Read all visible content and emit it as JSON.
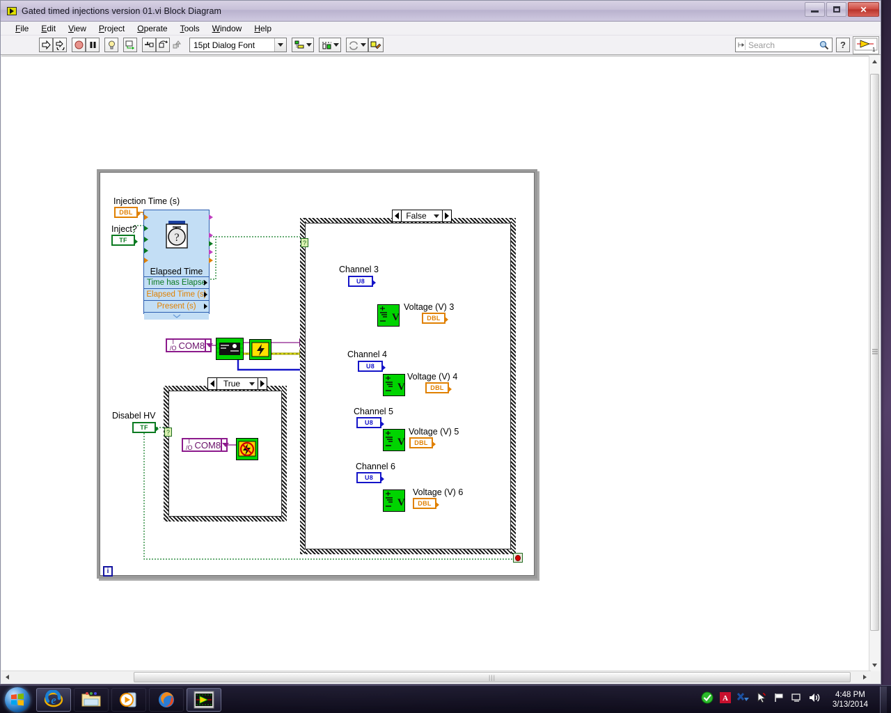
{
  "window": {
    "title": "Gated timed injections version 01.vi Block Diagram",
    "icon": "labview-vi-icon",
    "buttons": {
      "minimize": "minimize-button",
      "maximize": "maximize-button",
      "close": "✕"
    }
  },
  "menubar": {
    "items": [
      {
        "label": "File",
        "mnemonic": "F"
      },
      {
        "label": "Edit",
        "mnemonic": "E"
      },
      {
        "label": "View",
        "mnemonic": "V"
      },
      {
        "label": "Project",
        "mnemonic": "P"
      },
      {
        "label": "Operate",
        "mnemonic": "O"
      },
      {
        "label": "Tools",
        "mnemonic": "T"
      },
      {
        "label": "Window",
        "mnemonic": "W"
      },
      {
        "label": "Help",
        "mnemonic": "H"
      }
    ]
  },
  "toolbar": {
    "run": "run-arrow-icon",
    "run_continuously": "run-continuously-icon",
    "abort": "abort-execution-icon",
    "pause": "pause-icon",
    "highlight_execution": "lightbulb-icon",
    "retain_wire_values": "retain-wire-values-icon",
    "step_into": "step-into-icon",
    "step_over": "step-over-icon",
    "step_out": "step-out-icon",
    "font_selector": "15pt Dialog Font",
    "align_objects": "align-objects-icon",
    "distribute_objects": "distribute-objects-icon",
    "reorder": "reorder-icon",
    "clean_up_diagram": "clean-up-diagram-icon",
    "search_placeholder": "Search",
    "search_value": "",
    "help_label": "?"
  },
  "diagram": {
    "controls": [
      {
        "name": "injection-time",
        "label": "Injection Time (s)",
        "type": "DBL"
      },
      {
        "name": "inject",
        "label": "Inject?",
        "type": "TF"
      },
      {
        "name": "disabel-hv",
        "label": "Disabel HV",
        "type": "TF"
      }
    ],
    "express_vi": {
      "title": "Elapsed Time",
      "outputs": [
        "Time has Elapse",
        "Elapsed Time (s)",
        "Present (s)"
      ],
      "icon": "stopwatch-icon"
    },
    "visa_resources": [
      {
        "name": "visa-resource-main",
        "value": "COM8",
        "prefix": "I/O"
      },
      {
        "name": "visa-resource-true-case",
        "value": "COM8",
        "prefix": "I/O"
      }
    ],
    "case_structures": [
      {
        "name": "case-structure-false",
        "selector": "False"
      },
      {
        "name": "case-structure-true",
        "selector": "True"
      }
    ],
    "channels": [
      {
        "channel_label": "Channel 3",
        "channel_type": "U8",
        "indicator_label": "Voltage (V) 3",
        "indicator_type": "DBL"
      },
      {
        "channel_label": "Channel 4",
        "channel_type": "U8",
        "indicator_label": "Voltage (V) 4",
        "indicator_type": "DBL"
      },
      {
        "channel_label": "Channel 5",
        "channel_type": "U8",
        "indicator_label": "Voltage (V) 5",
        "indicator_type": "DBL"
      },
      {
        "channel_label": "Channel 6",
        "channel_type": "U8",
        "indicator_label": "Voltage (V) 6",
        "indicator_type": "DBL"
      }
    ],
    "loop": {
      "iteration_terminal": "i",
      "stop_terminal": "stop-button-terminal"
    },
    "subvis": [
      {
        "name": "serial-configure-vi",
        "icon": "instrument-icon"
      },
      {
        "name": "hv-enable-vi",
        "icon": "high-voltage-icon"
      },
      {
        "name": "hv-disable-vi",
        "icon": "hv-off-icon"
      },
      {
        "name": "read-voltage-vi-3",
        "icon": "voltmeter-icon"
      },
      {
        "name": "read-voltage-vi-4",
        "icon": "voltmeter-icon"
      },
      {
        "name": "read-voltage-vi-5",
        "icon": "voltmeter-icon"
      },
      {
        "name": "read-voltage-vi-6",
        "icon": "voltmeter-icon"
      }
    ],
    "colors": {
      "dbl_orange": "#e08000",
      "bool_green": "#0a7a20",
      "u8_blue": "#1414c8",
      "visa_purple": "#8c1a8c",
      "express_blue": "#c3def5",
      "subvi_green": "#00d400"
    }
  },
  "taskbar": {
    "start": "windows-start-orb",
    "apps": [
      {
        "name": "internet-explorer-icon"
      },
      {
        "name": "windows-explorer-icon"
      },
      {
        "name": "windows-media-player-icon"
      },
      {
        "name": "firefox-icon"
      },
      {
        "name": "labview-icon"
      }
    ],
    "tray": [
      {
        "name": "antivirus-tray-icon"
      },
      {
        "name": "adobe-tray-icon"
      },
      {
        "name": "xming-tray-icon"
      },
      {
        "name": "mouse-tray-icon"
      },
      {
        "name": "action-center-flag-icon"
      },
      {
        "name": "network-tray-icon"
      },
      {
        "name": "volume-tray-icon"
      }
    ],
    "clock": {
      "time": "4:48 PM",
      "date": "3/13/2014"
    }
  }
}
